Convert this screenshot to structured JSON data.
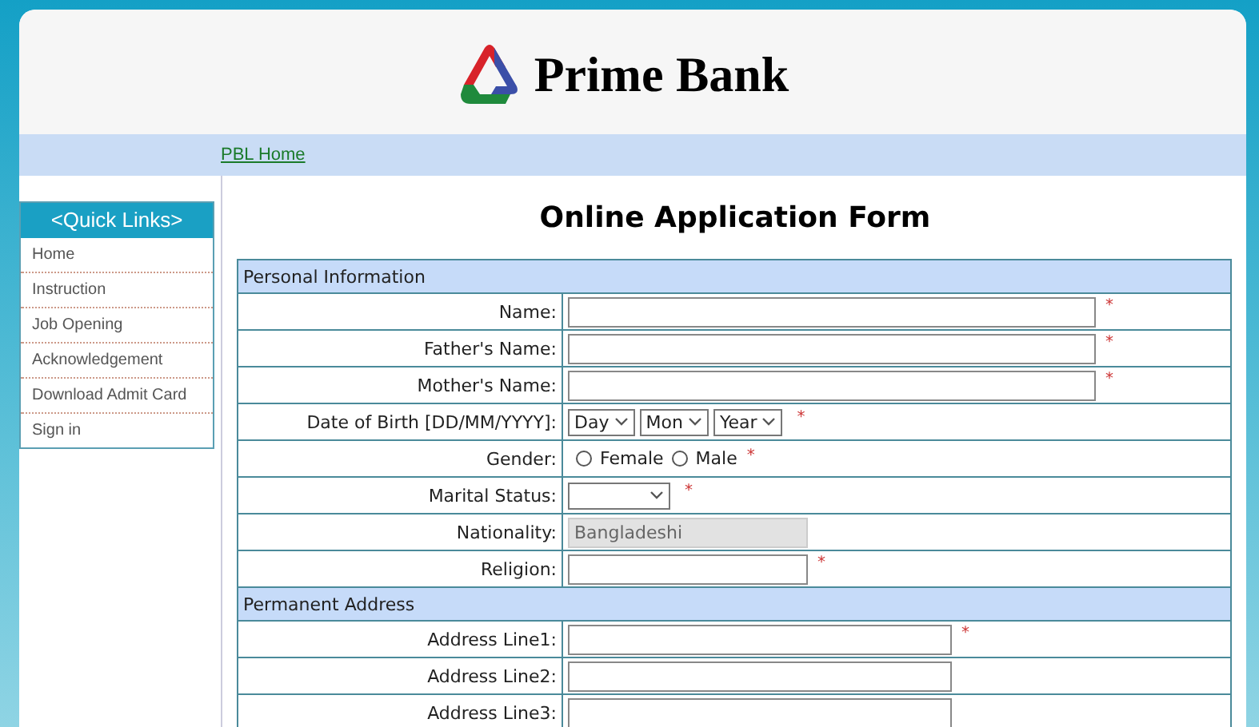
{
  "header": {
    "bank_name": "Prime Bank"
  },
  "nav": {
    "links": [
      "PBL Home"
    ]
  },
  "quick_links": {
    "title": "<Quick Links>",
    "items": [
      "Home",
      "Instruction",
      "Job Opening",
      "Acknowledgement",
      "Download Admit Card",
      "Sign in"
    ]
  },
  "form": {
    "title": "Online Application Form",
    "sections": [
      {
        "heading": "Personal Information",
        "rows": [
          {
            "label": "Name:",
            "kind": "longtext",
            "required_mark": "*"
          },
          {
            "label": "Father's Name:",
            "kind": "longtext",
            "required_mark": "*"
          },
          {
            "label": "Mother's Name:",
            "kind": "longtext",
            "required_mark": "*"
          },
          {
            "label": "Date of Birth [DD/MM/YYYY]:",
            "kind": "selects",
            "options": [
              "Day",
              "Mon",
              "Year"
            ],
            "required_mark": "*"
          },
          {
            "label": "Gender:",
            "kind": "radio",
            "options": [
              {
                "label": "Female",
                "selected": false
              },
              {
                "label": "Male",
                "selected": false
              }
            ],
            "required_mark": "*"
          },
          {
            "label": "Marital Status:",
            "kind": "select",
            "required_mark": "*"
          },
          {
            "label": "Nationality:",
            "kind": "shorttext",
            "value": "Bangladeshi",
            "disabled": true
          },
          {
            "label": "Religion:",
            "kind": "shorttext",
            "disabled": false,
            "required_mark": "*"
          }
        ]
      },
      {
        "heading": "Permanent Address",
        "rows": [
          {
            "label": "Address Line1:",
            "kind": "mediumtext",
            "required_mark": "*"
          },
          {
            "label": "Address Line2:",
            "kind": "mediumtext"
          },
          {
            "label": "Address Line3:",
            "kind": "mediumtext"
          }
        ]
      }
    ]
  }
}
